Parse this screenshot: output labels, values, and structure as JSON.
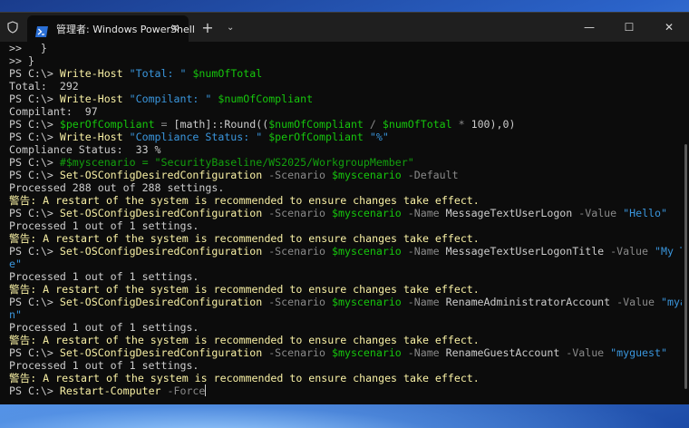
{
  "window": {
    "tab_title": "管理者: Windows PowerShell",
    "tab_close": "✕",
    "new_tab": "+",
    "dropdown": "⌄",
    "minimize": "—",
    "maximize": "☐",
    "close": "✕"
  },
  "colors": {
    "prompt": "#cccccc",
    "command": "#f9f1a5",
    "string": "#3a96dd",
    "variable": "#16c60c",
    "parameter": "#8a8a8a",
    "comment": "#13a10e",
    "warning": "#f9f1a5",
    "output": "#cccccc"
  },
  "lines": [
    [
      {
        "t": ">>   }",
        "c": "out"
      }
    ],
    [
      {
        "t": ">> }",
        "c": "out"
      }
    ],
    [
      {
        "t": "PS C:\\> ",
        "c": "prompt"
      },
      {
        "t": "Write-Host ",
        "c": "cmd"
      },
      {
        "t": "\"Total: \" ",
        "c": "str"
      },
      {
        "t": "$numOfTotal",
        "c": "var"
      }
    ],
    [
      {
        "t": "Total:  292",
        "c": "out"
      }
    ],
    [
      {
        "t": "PS C:\\> ",
        "c": "prompt"
      },
      {
        "t": "Write-Host ",
        "c": "cmd"
      },
      {
        "t": "\"Compilant: \" ",
        "c": "str"
      },
      {
        "t": "$numOfCompliant",
        "c": "var"
      }
    ],
    [
      {
        "t": "Compilant:  97",
        "c": "out"
      }
    ],
    [
      {
        "t": "PS C:\\> ",
        "c": "prompt"
      },
      {
        "t": "$perOfCompliant",
        "c": "var"
      },
      {
        "t": " = ",
        "c": "op"
      },
      {
        "t": "[math]::Round((",
        "c": "out"
      },
      {
        "t": "$numOfCompliant",
        "c": "var"
      },
      {
        "t": " / ",
        "c": "op"
      },
      {
        "t": "$numOfTotal",
        "c": "var"
      },
      {
        "t": " * ",
        "c": "op"
      },
      {
        "t": "100),0)",
        "c": "out"
      }
    ],
    [
      {
        "t": "PS C:\\> ",
        "c": "prompt"
      },
      {
        "t": "Write-Host ",
        "c": "cmd"
      },
      {
        "t": "\"Compliance Status: \" ",
        "c": "str"
      },
      {
        "t": "$perOfCompliant ",
        "c": "var"
      },
      {
        "t": "\"%\"",
        "c": "str"
      }
    ],
    [
      {
        "t": "Compliance Status:  33 %",
        "c": "out"
      }
    ],
    [
      {
        "t": "PS C:\\> ",
        "c": "prompt"
      },
      {
        "t": "#$myscenario = \"SecurityBaseline/WS2025/WorkgroupMember\"",
        "c": "comment"
      }
    ],
    [
      {
        "t": "PS C:\\> ",
        "c": "prompt"
      },
      {
        "t": "Set-OSConfigDesiredConfiguration ",
        "c": "cmd"
      },
      {
        "t": "-Scenario ",
        "c": "param"
      },
      {
        "t": "$myscenario ",
        "c": "var"
      },
      {
        "t": "-Default",
        "c": "param"
      }
    ],
    [
      {
        "t": "Processed 288 out of 288 settings.",
        "c": "out"
      }
    ],
    [
      {
        "t": "警告: A restart of the system is recommended to ensure changes take effect.",
        "c": "warn"
      }
    ],
    [
      {
        "t": "PS C:\\> ",
        "c": "prompt"
      },
      {
        "t": "Set-OSConfigDesiredConfiguration ",
        "c": "cmd"
      },
      {
        "t": "-Scenario ",
        "c": "param"
      },
      {
        "t": "$myscenario ",
        "c": "var"
      },
      {
        "t": "-Name ",
        "c": "param"
      },
      {
        "t": "MessageTextUserLogon ",
        "c": "out"
      },
      {
        "t": "-Value ",
        "c": "param"
      },
      {
        "t": "\"Hello\"",
        "c": "str"
      }
    ],
    [
      {
        "t": "Processed 1 out of 1 settings.",
        "c": "out"
      }
    ],
    [
      {
        "t": "警告: A restart of the system is recommended to ensure changes take effect.",
        "c": "warn"
      }
    ],
    [
      {
        "t": "PS C:\\> ",
        "c": "prompt"
      },
      {
        "t": "Set-OSConfigDesiredConfiguration ",
        "c": "cmd"
      },
      {
        "t": "-Scenario ",
        "c": "param"
      },
      {
        "t": "$myscenario ",
        "c": "var"
      },
      {
        "t": "-Name ",
        "c": "param"
      },
      {
        "t": "MessageTextUserLogonTitle ",
        "c": "out"
      },
      {
        "t": "-Value ",
        "c": "param"
      },
      {
        "t": "\"My Titl",
        "c": "str"
      }
    ],
    [
      {
        "t": "e\"",
        "c": "str"
      }
    ],
    [
      {
        "t": "Processed 1 out of 1 settings.",
        "c": "out"
      }
    ],
    [
      {
        "t": "警告: A restart of the system is recommended to ensure changes take effect.",
        "c": "warn"
      }
    ],
    [
      {
        "t": "PS C:\\> ",
        "c": "prompt"
      },
      {
        "t": "Set-OSConfigDesiredConfiguration ",
        "c": "cmd"
      },
      {
        "t": "-Scenario ",
        "c": "param"
      },
      {
        "t": "$myscenario ",
        "c": "var"
      },
      {
        "t": "-Name ",
        "c": "param"
      },
      {
        "t": "RenameAdministratorAccount ",
        "c": "out"
      },
      {
        "t": "-Value ",
        "c": "param"
      },
      {
        "t": "\"myadmi",
        "c": "str"
      }
    ],
    [
      {
        "t": "n\"",
        "c": "str"
      }
    ],
    [
      {
        "t": "Processed 1 out of 1 settings.",
        "c": "out"
      }
    ],
    [
      {
        "t": "警告: A restart of the system is recommended to ensure changes take effect.",
        "c": "warn"
      }
    ],
    [
      {
        "t": "PS C:\\> ",
        "c": "prompt"
      },
      {
        "t": "Set-OSConfigDesiredConfiguration ",
        "c": "cmd"
      },
      {
        "t": "-Scenario ",
        "c": "param"
      },
      {
        "t": "$myscenario ",
        "c": "var"
      },
      {
        "t": "-Name ",
        "c": "param"
      },
      {
        "t": "RenameGuestAccount ",
        "c": "out"
      },
      {
        "t": "-Value ",
        "c": "param"
      },
      {
        "t": "\"myguest\"",
        "c": "str"
      }
    ],
    [
      {
        "t": "Processed 1 out of 1 settings.",
        "c": "out"
      }
    ],
    [
      {
        "t": "警告: A restart of the system is recommended to ensure changes take effect.",
        "c": "warn"
      }
    ],
    [
      {
        "t": "PS C:\\> ",
        "c": "prompt"
      },
      {
        "t": "Restart-Computer ",
        "c": "cmd"
      },
      {
        "t": "-Force",
        "c": "param"
      }
    ]
  ]
}
